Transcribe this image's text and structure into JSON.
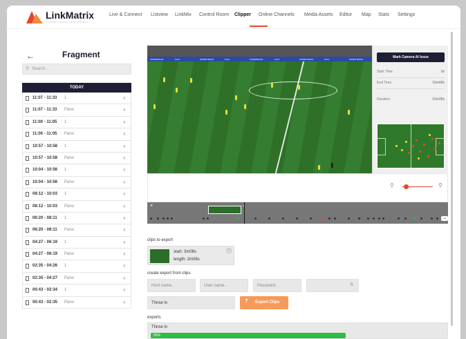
{
  "app": {
    "name": "LinkMatrix",
    "tagline": "IT WORKS & WORKS, LET'S CONNECT"
  },
  "nav": {
    "items": [
      {
        "label": "Live & Connect"
      },
      {
        "label": "Listview"
      },
      {
        "label": "LinkMix"
      },
      {
        "label": "Control Room"
      },
      {
        "label": "Clipper"
      },
      {
        "label": "Online Channels"
      },
      {
        "label": "Media Assets"
      },
      {
        "label": "Editor"
      },
      {
        "label": "Map"
      },
      {
        "label": "Stats"
      },
      {
        "label": "Settings"
      }
    ],
    "active": "Clipper"
  },
  "sidebar": {
    "title": "Fragment",
    "back_icon": "arrow-left-icon",
    "search_placeholder": "Search...",
    "section_label": "TODAY",
    "items": [
      {
        "time": "11:07 - 11:33",
        "label": "1"
      },
      {
        "time": "11:07 - 11:33",
        "label": "Pano"
      },
      {
        "time": "11:00 - 11:05",
        "label": "1"
      },
      {
        "time": "11:00 - 11:05",
        "label": "Pano"
      },
      {
        "time": "10:57 - 10:58",
        "label": "1"
      },
      {
        "time": "10:57 - 10:58",
        "label": "Pano"
      },
      {
        "time": "10:04 - 10:56",
        "label": "1"
      },
      {
        "time": "10:04 - 10:56",
        "label": "Pano"
      },
      {
        "time": "08:12 - 10:03",
        "label": "1"
      },
      {
        "time": "08:12 - 10:03",
        "label": "Pano"
      },
      {
        "time": "06:20 - 08:11",
        "label": "1"
      },
      {
        "time": "06:20 - 08:11",
        "label": "Pano"
      },
      {
        "time": "04:27 - 06:19",
        "label": "1"
      },
      {
        "time": "04:27 - 06:19",
        "label": "Pano"
      },
      {
        "time": "02:35 - 04:26",
        "label": "1"
      },
      {
        "time": "02:35 - 04:27",
        "label": "Pano"
      },
      {
        "time": "00:43 - 02:34",
        "label": "1"
      },
      {
        "time": "00:43 - 02:35",
        "label": "Pano"
      }
    ]
  },
  "video": {
    "ad_boards": [
      "SUPERBAHIS",
      "Fenix",
      "SUPER BAHIS",
      "Fenix",
      "SUPERBAHIS",
      "Fenix",
      "SUPER BAHIS",
      "Fenix",
      "SUPER BAHIS"
    ]
  },
  "info_panel": {
    "mark_button": "Mark Camera AI Issue",
    "start_time_label": "Start Time",
    "start_time_value": "0s",
    "end_time_label": "End Time",
    "end_time_value": "16m08s",
    "duration_label": "Duration",
    "duration_value": "16m08s"
  },
  "timeline": {
    "tag": "x0",
    "clip_close": "×",
    "close": "×"
  },
  "clips_to_export": {
    "label": "clips to export",
    "start": "start: 3m08s",
    "length": "length: 2m08s",
    "remove": "×"
  },
  "create_export": {
    "label": "create export from clips",
    "host_placeholder": "Host name..",
    "user_placeholder": "User name..",
    "password_placeholder": "Password..",
    "select_arrows": "⇅",
    "name_value": "Throw in",
    "export_button": "Export Clips",
    "export_icon": "upload-icon"
  },
  "exports": {
    "label": "exports",
    "items": [
      {
        "name": "Throw in",
        "progress": 65,
        "progress_text": "65%"
      }
    ]
  },
  "colors": {
    "accent": "#e8452c",
    "navy": "#1e1e36",
    "progress": "#2ebd42",
    "export_button": "#f59a59"
  }
}
